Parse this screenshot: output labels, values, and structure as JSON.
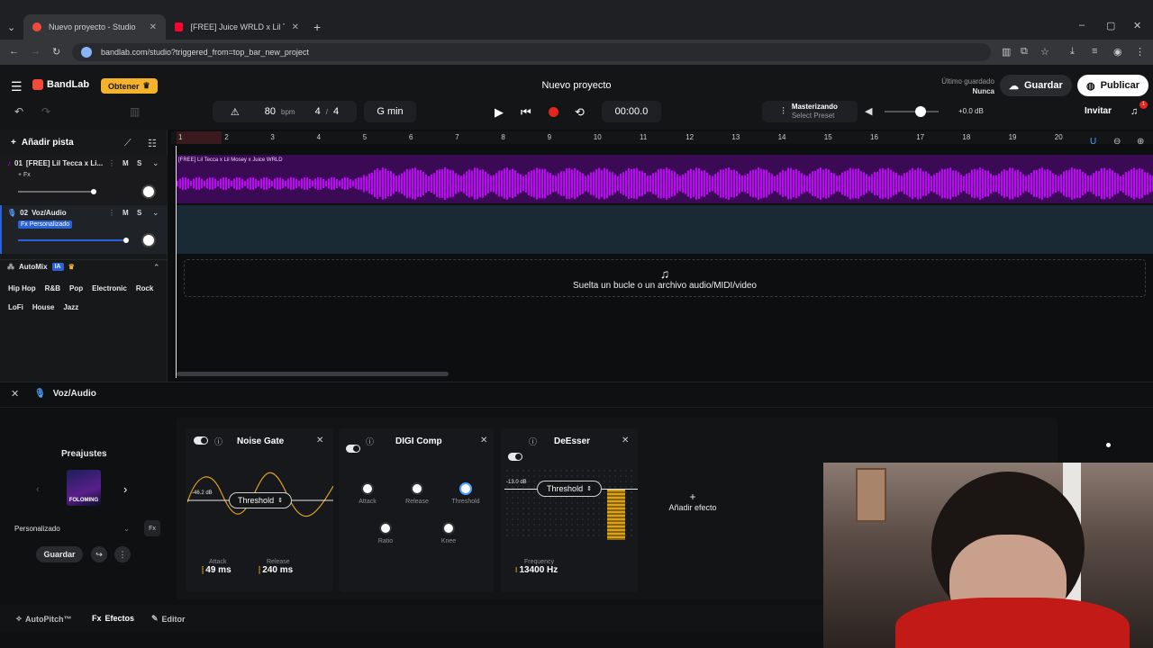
{
  "browser": {
    "tabs": [
      {
        "title": "Nuevo proyecto - Studio",
        "active": true
      },
      {
        "title": "[FREE] Juice WRLD x Lil Tecca Ty",
        "active": false
      }
    ],
    "url": "bandlab.com/studio?triggered_from=top_bar_new_project"
  },
  "app": {
    "brand": "BandLab",
    "obtener": "Obtener",
    "project_title": "Nuevo proyecto",
    "saved_label": "Último guardado",
    "saved_value": "Nunca",
    "guardar": "Guardar",
    "publicar": "Publicar",
    "invitar": "Invitar",
    "notification_count": "1"
  },
  "transport": {
    "tempo": "80",
    "tempo_unit": "bpm",
    "time_sig_num": "4",
    "time_sig_sep": "/",
    "time_sig_den": "4",
    "key": "G min",
    "time": "00:00.0",
    "mastering_title": "Masterizando",
    "mastering_preset": "Select Preset",
    "volume_db": "+0.0 dB"
  },
  "tracks_panel": {
    "add_track": "Añadir pista",
    "tracks": [
      {
        "num": "01",
        "name": "[FREE] Lil Tecca x Li...",
        "fx": "+ Fx",
        "mute": "M",
        "solo": "S"
      },
      {
        "num": "02",
        "name": "Voz/Audio",
        "fx": "Fx Personalizado",
        "mute": "M",
        "solo": "S"
      }
    ],
    "automix": "AutoMix",
    "automix_badge": "IA",
    "genres": [
      "Hip Hop",
      "R&B",
      "Pop",
      "Electronic",
      "Rock",
      "LoFi",
      "House",
      "Jazz"
    ]
  },
  "timeline": {
    "bars": [
      "1",
      "2",
      "3",
      "4",
      "5",
      "6",
      "7",
      "8",
      "9",
      "10",
      "11",
      "12",
      "13",
      "14",
      "15",
      "16",
      "17",
      "18",
      "19",
      "20"
    ],
    "clip_label": "[FREE] Lil Tecca x Lil Mosey x Juice WRLD",
    "drop_text": "Suelta un bucle o un archivo audio/MIDI/video"
  },
  "effects_panel": {
    "track_name": "Voz/Audio",
    "presets_title": "Preajustes",
    "preset_art_text": "FOLOMING",
    "preset_select": "Personalizado",
    "guardar": "Guardar",
    "add_effect": "Añadir efecto",
    "noise_gate": {
      "title": "Noise Gate",
      "threshold_label": "Threshold",
      "threshold_value": "-46.2 dB",
      "attack_label": "Attack",
      "attack_value": "49 ms",
      "release_label": "Release",
      "release_value": "240 ms"
    },
    "digi_comp": {
      "title": "DIGI Comp",
      "knobs": [
        "Attack",
        "Release",
        "Threshold",
        "Ratio",
        "Knee"
      ]
    },
    "deesser": {
      "title": "DeEsser",
      "threshold_label": "Threshold",
      "threshold_value": "-13.0 dB",
      "freq_label": "Frequency",
      "freq_value": "13400 Hz"
    }
  },
  "bottom_tabs": [
    "AutoPitch™",
    "Efectos",
    "Editor"
  ],
  "colors": {
    "accent_purple": "#c400ff",
    "record_red": "#e5261f",
    "obtener_yellow": "#f4b32a",
    "deesser_gold": "#d9a21b"
  }
}
